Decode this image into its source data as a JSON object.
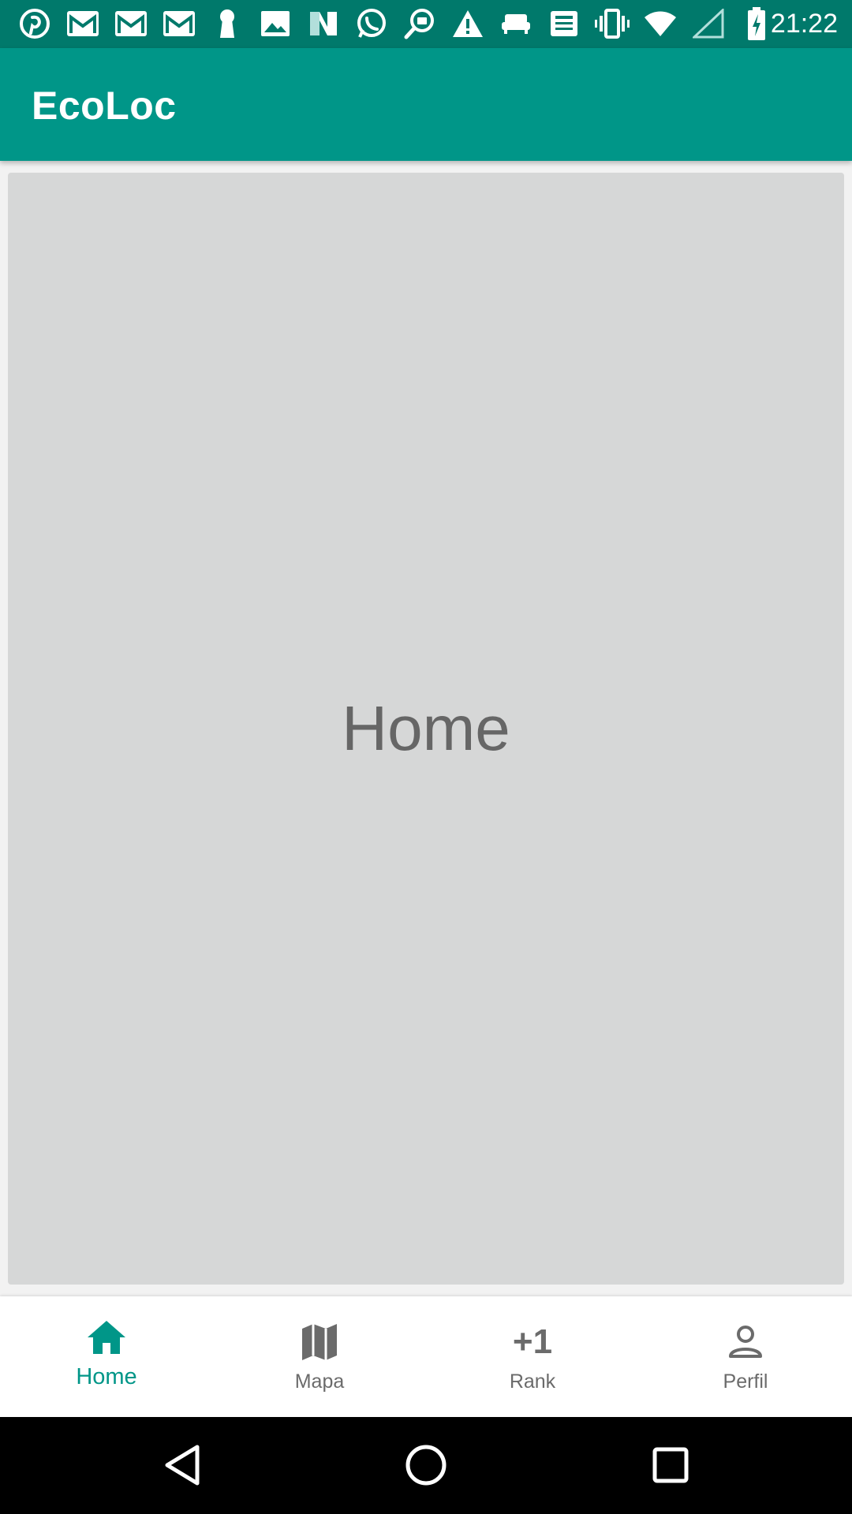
{
  "status_bar": {
    "time": "21:22",
    "icons": [
      "pinterest-icon",
      "gmail-icon",
      "gmail-icon",
      "gmail-icon",
      "keyhole-icon",
      "image-icon",
      "news-icon",
      "whatsapp-icon",
      "search-chat-icon",
      "warning-icon",
      "sofa-icon",
      "newspaper-icon",
      "vibrate-icon",
      "wifi-icon",
      "signal-icon",
      "battery-charging-icon"
    ],
    "color": "#00796b"
  },
  "app_bar": {
    "title": "EcoLoc",
    "color": "#009688"
  },
  "content": {
    "label": "Home"
  },
  "bottom_nav": {
    "items": [
      {
        "label": "Home",
        "icon": "home-icon",
        "active": true
      },
      {
        "label": "Mapa",
        "icon": "map-icon",
        "active": false
      },
      {
        "label": "Rank",
        "icon": "plus-one-icon",
        "glyph": "+1",
        "active": false
      },
      {
        "label": "Perfil",
        "icon": "person-icon",
        "active": false
      }
    ],
    "active_color": "#009688",
    "inactive_color": "#6b6b6b"
  },
  "system_nav": {
    "buttons": [
      "back-icon",
      "home-circle-icon",
      "recents-icon"
    ]
  }
}
